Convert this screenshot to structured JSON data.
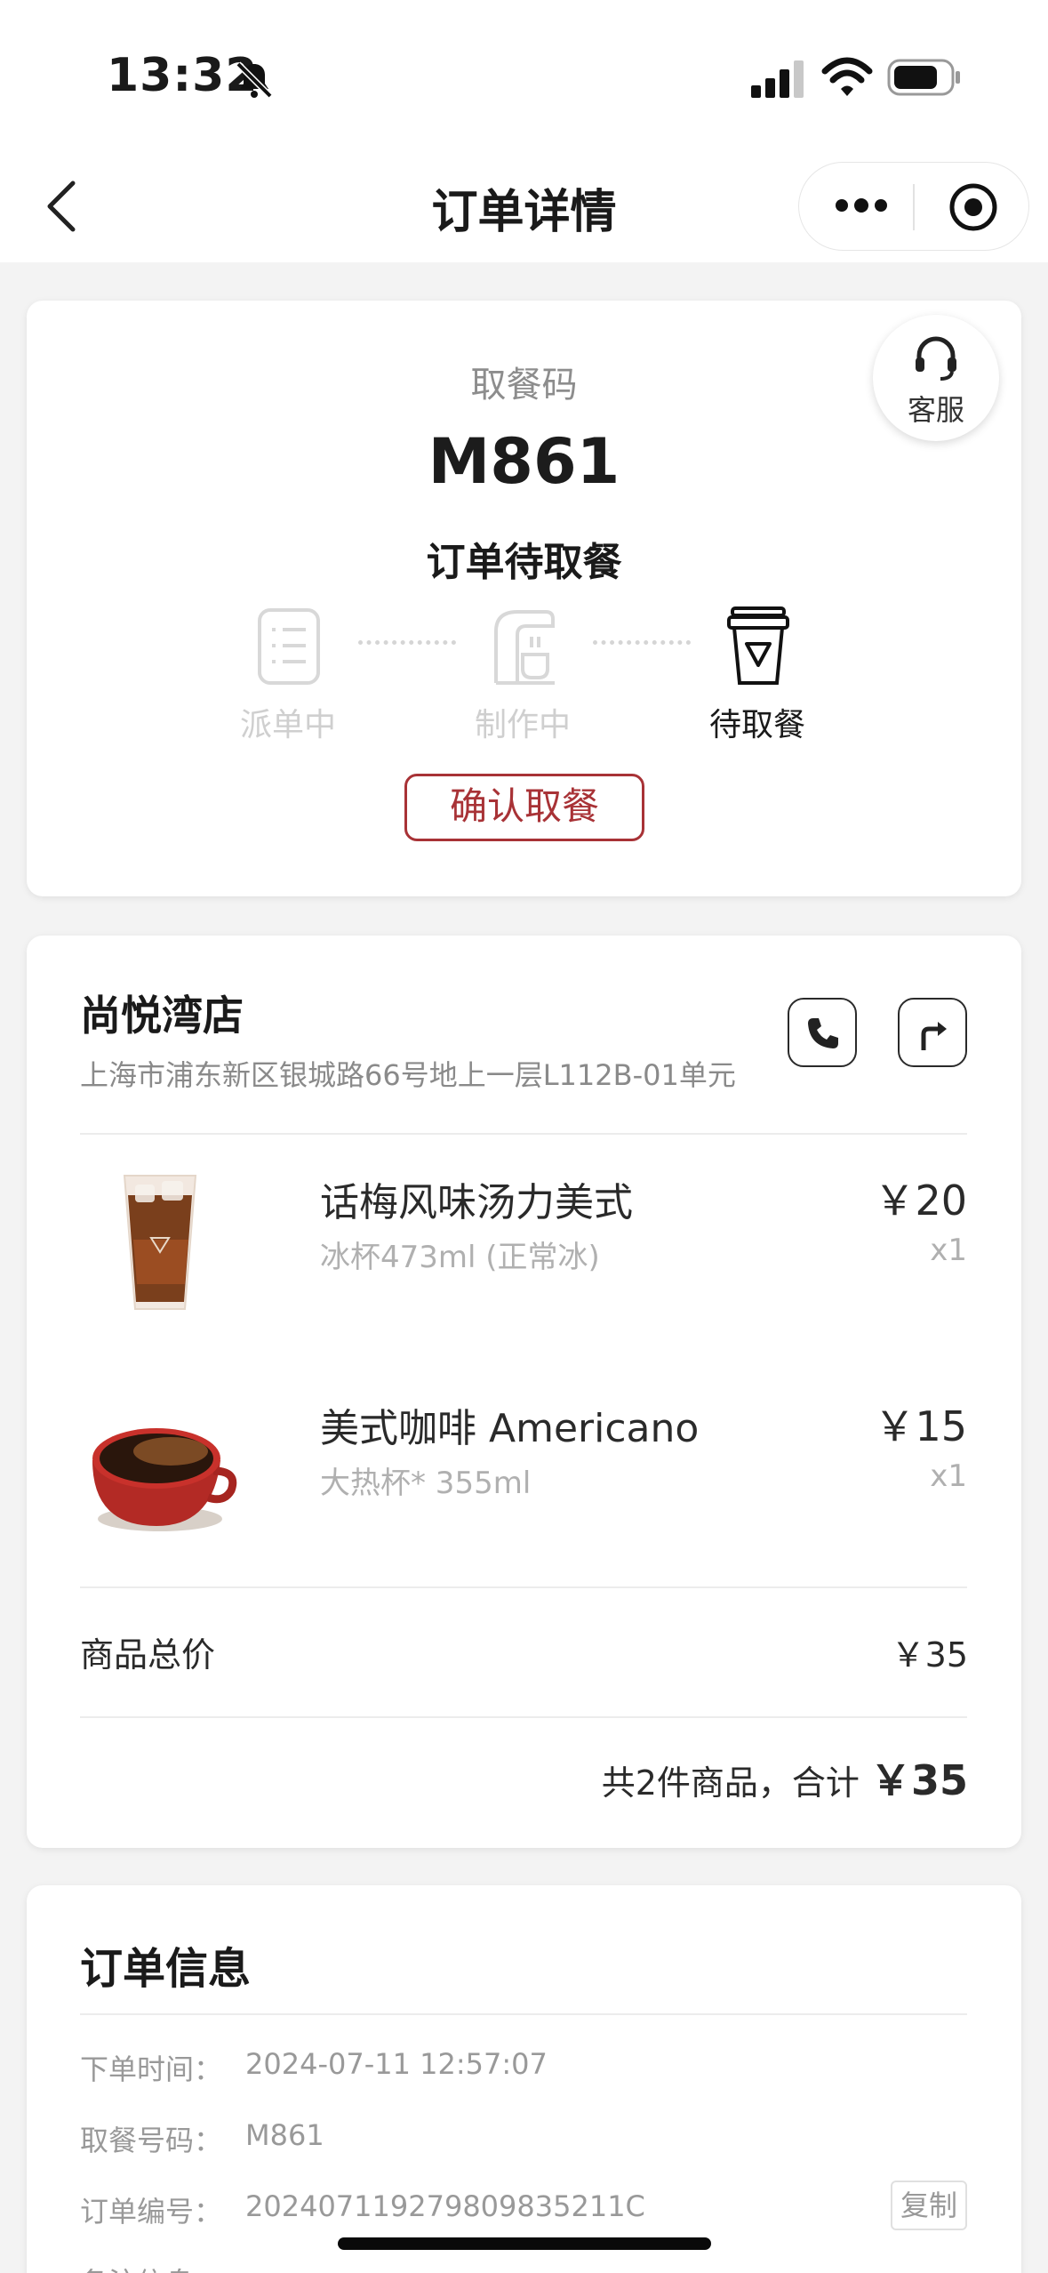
{
  "status_bar": {
    "time": "13:32"
  },
  "nav": {
    "title": "订单详情"
  },
  "pickup": {
    "label": "取餐码",
    "code": "M861",
    "status": "订单待取餐",
    "service_label": "客服",
    "steps": [
      {
        "label": "派单中",
        "state": "done"
      },
      {
        "label": "制作中",
        "state": "done"
      },
      {
        "label": "待取餐",
        "state": "active"
      }
    ],
    "confirm_label": "确认取餐"
  },
  "store": {
    "name": "尚悦湾店",
    "address": "上海市浦东新区银城路66号地上一层L112B-01单元",
    "items": [
      {
        "name": "话梅风味汤力美式",
        "spec": "冰杯473ml (正常冰)",
        "price": "￥20",
        "qty": "x1",
        "icon": "iced-coffee-image"
      },
      {
        "name": "美式咖啡 Americano",
        "spec": "大热杯* 355ml",
        "price": "￥15",
        "qty": "x1",
        "icon": "hot-coffee-image"
      }
    ],
    "subtotal_label": "商品总价",
    "subtotal_value": "￥35",
    "total_prefix": "共2件商品，合计",
    "total_value": "￥35"
  },
  "order_info": {
    "title": "订单信息",
    "rows": [
      {
        "key": "下单时间：",
        "value": "2024-07-11 12:57:07"
      },
      {
        "key": "取餐号码：",
        "value": "M861"
      },
      {
        "key": "订单编号：",
        "value": "202407119279809835211C"
      },
      {
        "key": "备注信息：",
        "value": ""
      }
    ],
    "copy_label": "复制"
  },
  "colors": {
    "accent": "#a83236",
    "background": "#f3f3f3",
    "muted": "#999999"
  }
}
